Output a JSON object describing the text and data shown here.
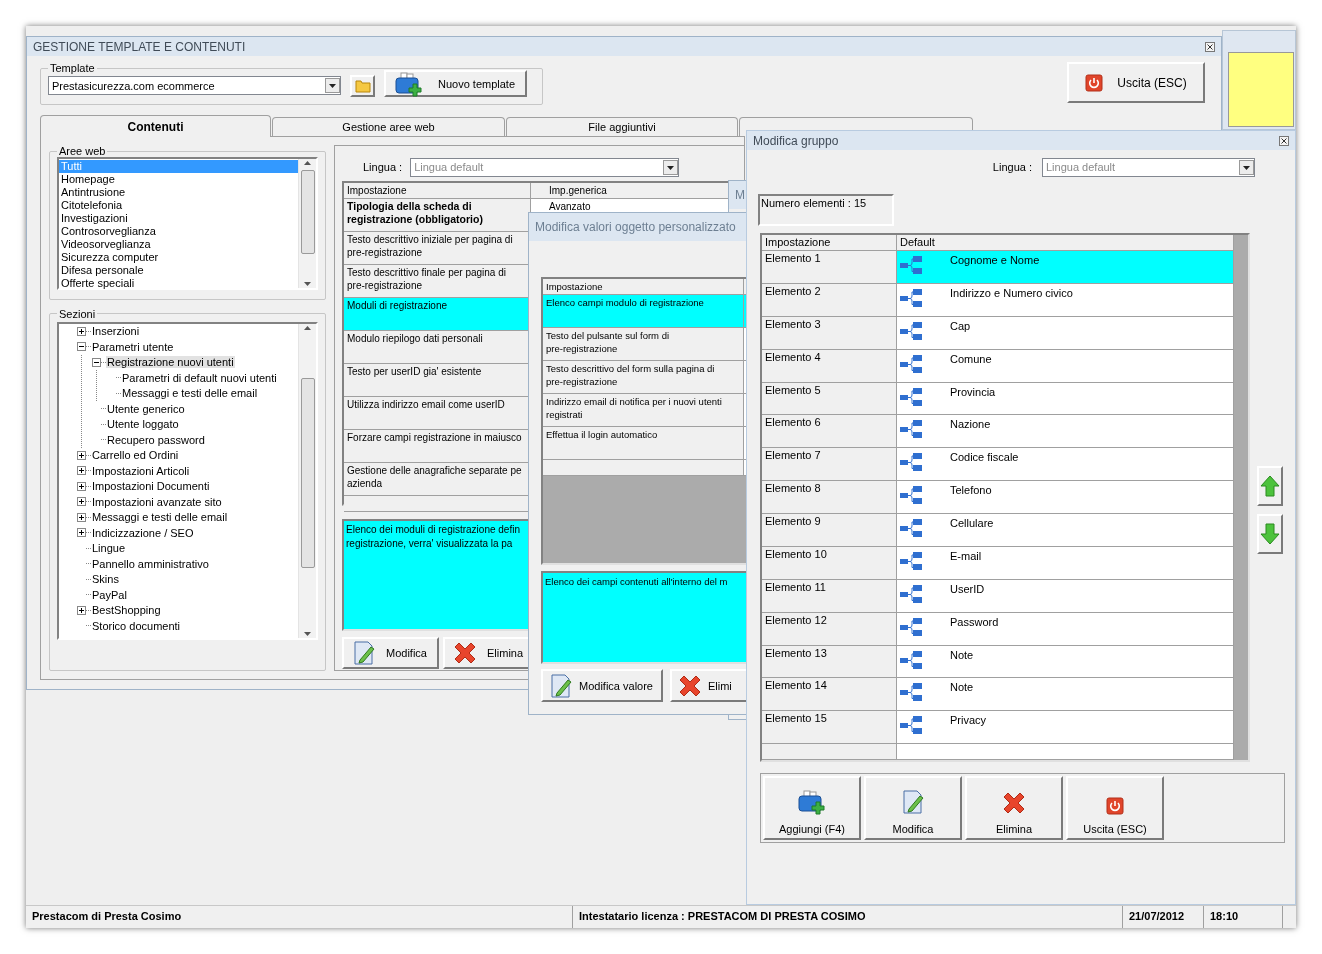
{
  "main_window": {
    "title": "GESTIONE TEMPLATE E CONTENUTI",
    "template_group": {
      "label": "Template",
      "value": "Prestasicurezza.com ecommerce",
      "new_button": "Nuovo template"
    },
    "exit_button": {
      "kind": "exit",
      "label": "Uscita (ESC)"
    },
    "tabs": [
      {
        "label": "Contenuti",
        "selected": true
      },
      {
        "label": "Gestione aree web",
        "selected": false
      },
      {
        "label": "File aggiuntivi",
        "selected": false
      },
      {
        "selected": false
      }
    ],
    "web_areas": {
      "label": "Aree web",
      "items": [
        {
          "label": "Tutti",
          "selected": true
        },
        {
          "label": "Homepage",
          "selected": false
        },
        {
          "label": "Antintrusione",
          "selected": false
        },
        {
          "label": "Citotelefonia",
          "selected": false
        },
        {
          "label": "Investigazioni",
          "selected": false
        },
        {
          "label": "Controsorveglianza",
          "selected": false
        },
        {
          "label": "Videosorveglianza",
          "selected": false
        },
        {
          "label": "Sicurezza computer",
          "selected": false
        },
        {
          "label": "Difesa personale",
          "selected": false
        },
        {
          "label": "Offerte speciali",
          "selected": false
        }
      ]
    },
    "sections": {
      "label": "Sezioni",
      "items": [
        {
          "label": "Inserzioni",
          "kind": "branch",
          "expanded": false,
          "selected": false
        },
        {
          "label": "Parametri utente",
          "kind": "branch",
          "expanded": true,
          "selected": false,
          "children": [
            {
              "label": "Registrazione nuovi utenti",
              "kind": "branch",
              "expanded": true,
              "selected": true,
              "children": [
                {
                  "label": "Parametri di default nuovi utenti",
                  "kind": "leaf",
                  "expanded": false,
                  "selected": false
                },
                {
                  "label": "Messaggi e testi delle email",
                  "kind": "leaf",
                  "expanded": false,
                  "selected": false
                }
              ]
            },
            {
              "label": "Utente generico",
              "kind": "leaf",
              "expanded": false,
              "selected": false
            },
            {
              "label": "Utente loggato",
              "kind": "leaf",
              "expanded": false,
              "selected": false
            },
            {
              "label": "Recupero password",
              "kind": "leaf",
              "expanded": false,
              "selected": false
            }
          ]
        },
        {
          "label": "Carrello ed Ordini",
          "kind": "branch",
          "expanded": false,
          "selected": false
        },
        {
          "label": "Impostazioni Articoli",
          "kind": "branch",
          "expanded": false,
          "selected": false
        },
        {
          "label": "Impostazioni Documenti",
          "kind": "branch",
          "expanded": false,
          "selected": false
        },
        {
          "label": "Impostazioni avanzate sito",
          "kind": "branch",
          "expanded": false,
          "selected": false
        },
        {
          "label": "Messaggi e testi delle email",
          "kind": "branch",
          "expanded": false,
          "selected": false
        },
        {
          "label": "Indicizzazione / SEO",
          "kind": "branch",
          "expanded": false,
          "selected": false
        },
        {
          "label": "Lingue",
          "kind": "leaf",
          "expanded": false,
          "selected": false
        },
        {
          "label": "Pannello amministrativo",
          "kind": "leaf",
          "expanded": false,
          "selected": false
        },
        {
          "label": "Skins",
          "kind": "leaf",
          "expanded": false,
          "selected": false
        },
        {
          "label": "PayPal",
          "kind": "leaf",
          "expanded": false,
          "selected": false
        },
        {
          "label": "BestShopping",
          "kind": "branch",
          "expanded": false,
          "selected": false
        },
        {
          "label": "Storico documenti",
          "kind": "leaf",
          "expanded": false,
          "selected": false
        }
      ]
    },
    "settings": {
      "language_label": "Lingua :",
      "language_value": "Lingua default",
      "columns": [
        "Impostazione",
        "Imp.generica"
      ],
      "rows": [
        {
          "label": "Tipologia della scheda di\nregistrazione (obbligatorio)",
          "value": "Avanzato",
          "bold": true,
          "selected": false
        },
        {
          "label": "Testo descrittivo iniziale per pagina di\npre-registrazione",
          "bold": false,
          "selected": false
        },
        {
          "label": "Testo descrittivo finale per pagina di\npre-registrazione",
          "bold": false,
          "selected": false
        },
        {
          "label": "Moduli di registrazione",
          "bold": false,
          "selected": true
        },
        {
          "label": "Modulo riepilogo dati personali",
          "bold": false,
          "selected": false
        },
        {
          "label": "Testo per userID gia' esistente",
          "bold": false,
          "selected": false
        },
        {
          "label": "Utilizza indirizzo email come userID",
          "bold": false,
          "selected": false
        },
        {
          "label": "Forzare campi registrazione in maiusco",
          "bold": false,
          "selected": false
        },
        {
          "label": "Gestione delle anagrafiche separate pe\nazienda",
          "bold": false,
          "selected": false
        }
      ],
      "description": "Elenco dei moduli di registrazione defin\nregistrazione, verra' visualizzata la pa",
      "buttons": [
        {
          "kind": "edit",
          "label": "Modifica"
        },
        {
          "kind": "delete",
          "label": "Elimina"
        }
      ]
    }
  },
  "background_dialog": {
    "title": "M"
  },
  "custom_dialog": {
    "title": "Modifica valori oggetto personalizzato",
    "column": "Impostazione",
    "rows": [
      {
        "label": "Elenco campi modulo di registrazione",
        "selected": true
      },
      {
        "label": "Testo del pulsante sul form di\npre-registrazione",
        "selected": false
      },
      {
        "label": "Testo descrittivo del form sulla pagina di\npre-registrazione",
        "selected": false
      },
      {
        "label": "Indirizzo email di notifica per i nuovi utenti\nregistrati",
        "selected": false
      },
      {
        "label": "Effettua il login automatico",
        "selected": false
      }
    ],
    "description": "Elenco dei campi contenuti all'interno del m",
    "buttons": [
      {
        "kind": "edit",
        "label": "Modifica valore"
      },
      {
        "kind": "delete",
        "label": "Elimi"
      }
    ]
  },
  "group_dialog": {
    "title": "Modifica gruppo",
    "language_label": "Lingua :",
    "language_value": "Lingua default",
    "count": "Numero elementi : 15",
    "columns": [
      "Impostazione",
      "Default"
    ],
    "rows": [
      {
        "label": "Elemento 1",
        "value": "Cognome e Nome",
        "selected": true
      },
      {
        "label": "Elemento 2",
        "value": "Indirizzo e Numero civico",
        "selected": false
      },
      {
        "label": "Elemento 3",
        "value": "Cap",
        "selected": false
      },
      {
        "label": "Elemento 4",
        "value": "Comune",
        "selected": false
      },
      {
        "label": "Elemento 5",
        "value": "Provincia",
        "selected": false
      },
      {
        "label": "Elemento 6",
        "value": "Nazione",
        "selected": false
      },
      {
        "label": "Elemento 7",
        "value": "Codice fiscale",
        "selected": false
      },
      {
        "label": "Elemento 8",
        "value": "Telefono",
        "selected": false
      },
      {
        "label": "Elemento 9",
        "value": "Cellulare",
        "selected": false
      },
      {
        "label": "Elemento 10",
        "value": "E-mail",
        "selected": false
      },
      {
        "label": "Elemento 11",
        "value": "UserID",
        "selected": false
      },
      {
        "label": "Elemento 12",
        "value": "Password",
        "selected": false
      },
      {
        "label": "Elemento 13",
        "value": "Note",
        "selected": false
      },
      {
        "label": "Elemento 14",
        "value": "Note",
        "selected": false
      },
      {
        "label": "Elemento 15",
        "value": "Privacy",
        "selected": false
      }
    ],
    "buttons": [
      {
        "kind": "add",
        "label": "Aggiungi (F4)"
      },
      {
        "kind": "edit",
        "label": "Modifica"
      },
      {
        "kind": "delete",
        "label": "Elimina"
      },
      {
        "kind": "exit",
        "label": "Uscita (ESC)"
      }
    ]
  },
  "status_bar": [
    "Prestacom di Presta Cosimo",
    "Intestatario licenza : PRESTACOM DI PRESTA COSIMO",
    "21/07/2012",
    "18:10"
  ]
}
